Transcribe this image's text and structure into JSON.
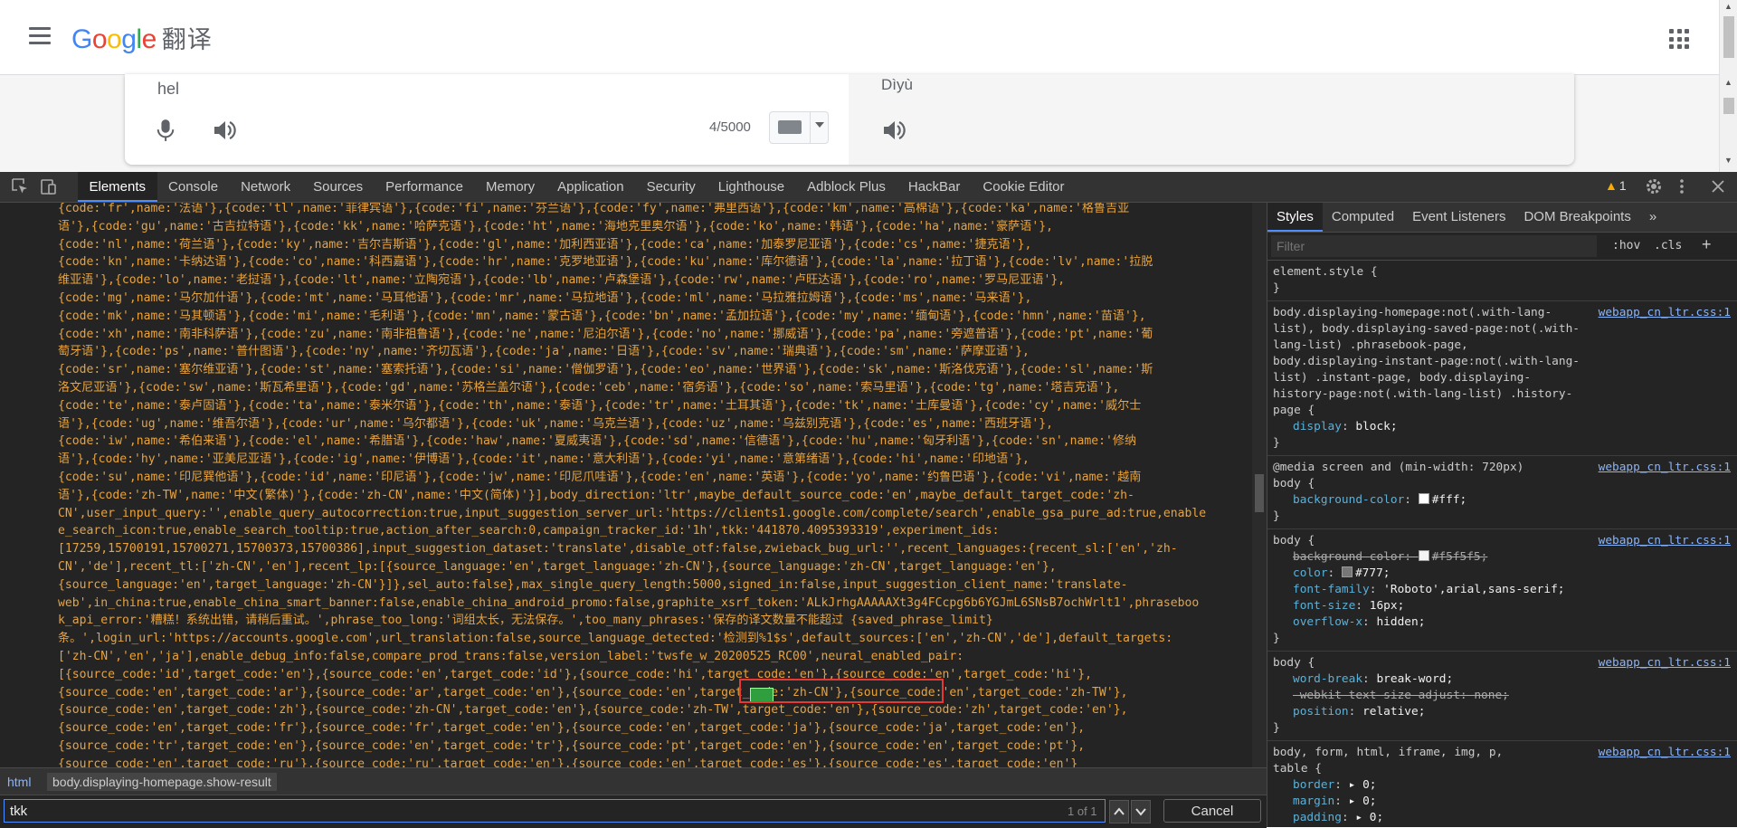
{
  "app": {
    "logo_letters": [
      "G",
      "o",
      "o",
      "g",
      "l",
      "e"
    ],
    "product": "翻译",
    "colors": {
      "blue": "#4285f4",
      "red": "#ea4335",
      "yellow": "#fbbc05",
      "green": "#34a853"
    }
  },
  "translator": {
    "source_text": "hel",
    "target_text": "Dìyù",
    "char_count": "4/5000"
  },
  "devtools": {
    "tabs": [
      "Elements",
      "Console",
      "Network",
      "Sources",
      "Performance",
      "Memory",
      "Application",
      "Security",
      "Lighthouse",
      "Adblock Plus",
      "HackBar",
      "Cookie Editor"
    ],
    "active_tab": "Elements",
    "warning_count": "1",
    "code_lines": [
      "{code:'fr',name:'法语'},{code:'tl',name:'菲律宾语'},{code:'fi',name:'芬兰语'},{code:'fy',name:'弗里西语'},{code:'km',name:'高棉语'},{code:'ka',name:'格鲁吉亚",
      "语'},{code:'gu',name:'古吉拉特语'},{code:'kk',name:'哈萨克语'},{code:'ht',name:'海地克里奥尔语'},{code:'ko',name:'韩语'},{code:'ha',name:'豪萨语'},",
      "{code:'nl',name:'荷兰语'},{code:'ky',name:'吉尔吉斯语'},{code:'gl',name:'加利西亚语'},{code:'ca',name:'加泰罗尼亚语'},{code:'cs',name:'捷克语'},",
      "{code:'kn',name:'卡纳达语'},{code:'co',name:'科西嘉语'},{code:'hr',name:'克罗地亚语'},{code:'ku',name:'库尔德语'},{code:'la',name:'拉丁语'},{code:'lv',name:'拉脱",
      "维亚语'},{code:'lo',name:'老挝语'},{code:'lt',name:'立陶宛语'},{code:'lb',name:'卢森堡语'},{code:'rw',name:'卢旺达语'},{code:'ro',name:'罗马尼亚语'},",
      "{code:'mg',name:'马尔加什语'},{code:'mt',name:'马耳他语'},{code:'mr',name:'马拉地语'},{code:'ml',name:'马拉雅拉姆语'},{code:'ms',name:'马来语'},",
      "{code:'mk',name:'马其顿语'},{code:'mi',name:'毛利语'},{code:'mn',name:'蒙古语'},{code:'bn',name:'孟加拉语'},{code:'my',name:'缅甸语'},{code:'hmn',name:'苗语'},",
      "{code:'xh',name:'南非科萨语'},{code:'zu',name:'南非祖鲁语'},{code:'ne',name:'尼泊尔语'},{code:'no',name:'挪威语'},{code:'pa',name:'旁遮普语'},{code:'pt',name:'葡",
      "萄牙语'},{code:'ps',name:'普什图语'},{code:'ny',name:'齐切瓦语'},{code:'ja',name:'日语'},{code:'sv',name:'瑞典语'},{code:'sm',name:'萨摩亚语'},",
      "{code:'sr',name:'塞尔维亚语'},{code:'st',name:'塞索托语'},{code:'si',name:'僧伽罗语'},{code:'eo',name:'世界语'},{code:'sk',name:'斯洛伐克语'},{code:'sl',name:'斯",
      "洛文尼亚语'},{code:'sw',name:'斯瓦希里语'},{code:'gd',name:'苏格兰盖尔语'},{code:'ceb',name:'宿务语'},{code:'so',name:'索马里语'},{code:'tg',name:'塔吉克语'},",
      "{code:'te',name:'泰卢固语'},{code:'ta',name:'泰米尔语'},{code:'th',name:'泰语'},{code:'tr',name:'土耳其语'},{code:'tk',name:'土库曼语'},{code:'cy',name:'威尔士",
      "语'},{code:'ug',name:'维吾尔语'},{code:'ur',name:'乌尔都语'},{code:'uk',name:'乌克兰语'},{code:'uz',name:'乌兹别克语'},{code:'es',name:'西班牙语'},",
      "{code:'iw',name:'希伯来语'},{code:'el',name:'希腊语'},{code:'haw',name:'夏威夷语'},{code:'sd',name:'信德语'},{code:'hu',name:'匈牙利语'},{code:'sn',name:'修纳",
      "语'},{code:'hy',name:'亚美尼亚语'},{code:'ig',name:'伊博语'},{code:'it',name:'意大利语'},{code:'yi',name:'意第绪语'},{code:'hi',name:'印地语'},",
      "{code:'su',name:'印尼巽他语'},{code:'id',name:'印尼语'},{code:'jw',name:'印尼爪哇语'},{code:'en',name:'英语'},{code:'yo',name:'约鲁巴语'},{code:'vi',name:'越南",
      "语'},{code:'zh-TW',name:'中文(繁体)'},{code:'zh-CN',name:'中文(简体)'}],body_direction:'ltr',maybe_default_source_code:'en',maybe_default_target_code:'zh-",
      "CN',user_input_query:'',enable_query_autocorrection:true,input_suggestion_server_url:'https://clients1.google.com/complete/search',enable_gsa_pure_ad:true,enable",
      "e_search_icon:true,enable_search_tooltip:true,action_after_search:0,campaign_tracker_id:'1h',tkk:'441870.4095393319',experiment_ids:",
      "[17259,15700191,15700271,15700373,15700386],input_suggestion_dataset:'translate',disable_otf:false,zwieback_bug_url:'',recent_languages:{recent_sl:['en','zh-",
      "CN','de'],recent_tl:['zh-CN','en'],recent_lp:[{source_language:'en',target_language:'zh-CN'},{source_language:'zh-CN',target_language:'en'},",
      "{source_language:'en',target_language:'zh-CN'}]},sel_auto:false},max_single_query_length:5000,signed_in:false,input_suggestion_client_name:'translate-",
      "web',in_china:true,enable_china_smart_banner:false,enable_china_android_promo:false,graphite_xsrf_token:'ALkJrhgAAAAAXt3g4FCcpg6b6YGJmL6SNsB7ochWrlt1',phraseboo",
      "k_api_error:'糟糕！系统出错，请稍后重试。',phrase_too_long:'词组太长，无法保存。',too_many_phrases:'保存的译文数量不能超过 {saved_phrase_limit}",
      "条。',login_url:'https://accounts.google.com',url_translation:false,source_language_detected:'检测到%1$s',default_sources:['en','zh-CN','de'],default_targets:",
      "['zh-CN','en','ja'],enable_debug_info:false,compare_prod_trans:false,version_label:'twsfe_w_20200525_RC00',neural_enabled_pair:",
      "[{source_code:'id',target_code:'en'},{source_code:'en',target_code:'id'},{source_code:'hi',target_code:'en'},{source_code:'en',target_code:'hi'},",
      "{source_code:'en',target_code:'ar'},{source_code:'ar',target_code:'en'},{source_code:'en',target_code:'zh-CN'},{source_code:'en',target_code:'zh-TW'},",
      "{source_code:'en',target_code:'zh'},{source_code:'zh-CN',target_code:'en'},{source_code:'zh-TW',target_code:'en'},{source_code:'zh',target_code:'en'},",
      "{source_code:'en',target_code:'fr'},{source_code:'fr',target_code:'en'},{source_code:'en',target_code:'ja'},{source_code:'ja',target_code:'en'},",
      "{source_code:'tr',target_code:'en'},{source_code:'en',target_code:'tr'},{source_code:'pt',target_code:'en'},{source_code:'en',target_code:'pt'},",
      "{source_code:'en',target_code:'ru'},{source_code:'ru',target_code:'en'},{source_code:'en',target_code:'es'},{source_code:'es',target_code:'en'}"
    ],
    "breadcrumbs": [
      "html",
      "body.displaying-homepage.show-result"
    ],
    "search": {
      "value": "tkk",
      "match_count": "1 of 1",
      "cancel_label": "Cancel"
    },
    "styles_tabs": [
      "Styles",
      "Computed",
      "Event Listeners",
      "DOM Breakpoints",
      "»"
    ],
    "filter_placeholder": "Filter",
    "hov_label": ":hov",
    "cls_label": ".cls",
    "plus_label": "+",
    "rules": [
      {
        "selector": "element.style {",
        "source": "",
        "decls": [],
        "close": "}"
      },
      {
        "selector": "body.displaying-homepage:not(.with-lang-list), body.displaying-saved-page:not(.with-lang-list) .phrasebook-page, body.displaying-instant-page:not(.with-lang-list) .instant-page, body.displaying-history-page:not(.with-lang-list) .history-page {",
        "source": "webapp_cn_ltr.css:1",
        "decls": [
          {
            "p": "display",
            "v": "block;"
          }
        ],
        "close": "}"
      },
      {
        "selector": "@media screen and (min-width: 720px)\nbody {",
        "source": "webapp_cn_ltr.css:1",
        "decls": [
          {
            "p": "background-color",
            "v": "#fff;",
            "swatch": "#ffffff"
          }
        ],
        "close": "}"
      },
      {
        "selector": "body {",
        "source": "webapp_cn_ltr.css:1",
        "decls": [
          {
            "p": "background-color",
            "v": "#f5f5f5;",
            "swatch": "#f5f5f5",
            "strike": true
          },
          {
            "p": "color",
            "v": "#777;",
            "swatch": "#777777"
          },
          {
            "p": "font-family",
            "v": "'Roboto',arial,sans-serif;"
          },
          {
            "p": "font-size",
            "v": "16px;"
          },
          {
            "p": "overflow-x",
            "v": "hidden;"
          }
        ],
        "close": "}"
      },
      {
        "selector": "body {",
        "source": "webapp_cn_ltr.css:1",
        "decls": [
          {
            "p": "word-break",
            "v": "break-word;"
          },
          {
            "p": "-webkit-text-size-adjust",
            "v": "none;",
            "strike": true
          },
          {
            "p": "position",
            "v": "relative;"
          }
        ],
        "close": "}"
      },
      {
        "selector": "body, form, html, iframe, img, p,\ntable {",
        "source": "webapp_cn_ltr.css:1",
        "decls": [
          {
            "p": "border",
            "v": "▸ 0;"
          },
          {
            "p": "margin",
            "v": "▸ 0;"
          },
          {
            "p": "padding",
            "v": "▸ 0;"
          }
        ],
        "close": "}"
      }
    ]
  }
}
